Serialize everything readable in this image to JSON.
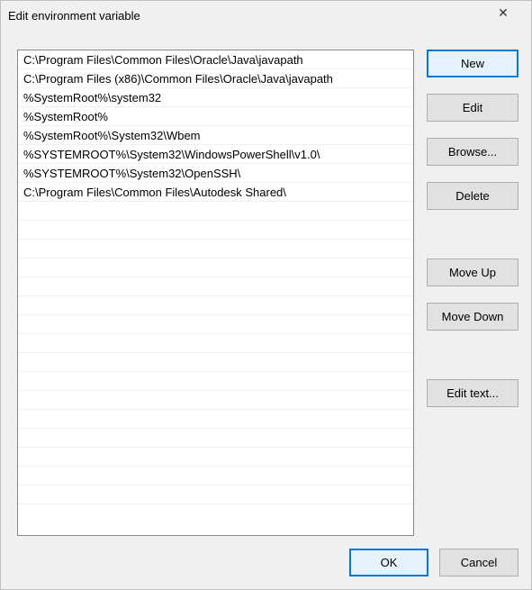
{
  "titlebar": {
    "title": "Edit environment variable",
    "close_glyph": "✕"
  },
  "path_entries": [
    "C:\\Program Files\\Common Files\\Oracle\\Java\\javapath",
    "C:\\Program Files (x86)\\Common Files\\Oracle\\Java\\javapath",
    "%SystemRoot%\\system32",
    "%SystemRoot%",
    "%SystemRoot%\\System32\\Wbem",
    "%SYSTEMROOT%\\System32\\WindowsPowerShell\\v1.0\\",
    "%SYSTEMROOT%\\System32\\OpenSSH\\",
    "C:\\Program Files\\Common Files\\Autodesk Shared\\"
  ],
  "buttons": {
    "new": "New",
    "edit": "Edit",
    "browse": "Browse...",
    "delete": "Delete",
    "move_up": "Move Up",
    "move_down": "Move Down",
    "edit_text": "Edit text...",
    "ok": "OK",
    "cancel": "Cancel"
  }
}
